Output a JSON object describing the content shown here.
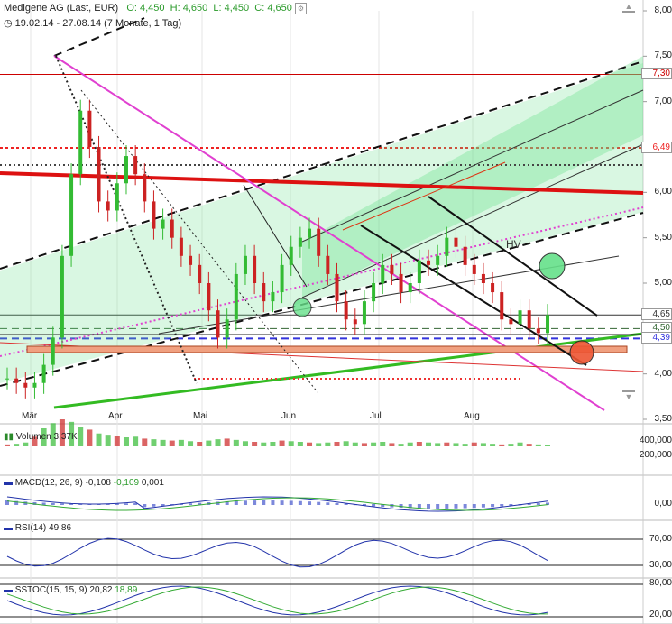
{
  "header": {
    "name": "Medigene AG (Last, EUR)",
    "open": "O: 4,450",
    "high": "H: 4,650",
    "low": "L: 4,450",
    "close": "C: 4,650",
    "range": "19.02.14 - 27.08.14 (7 Monate, 1 Tag)"
  },
  "chart_data": [
    {
      "type": "line",
      "title": "Medigene AG (Last, EUR)",
      "yticks": [
        "8,00",
        "7,50",
        "7,00",
        "6,50",
        "6,00",
        "5,50",
        "5,00",
        "4,50",
        "4,00",
        "3,50"
      ],
      "ylim": [
        3.5,
        8.0
      ],
      "xticks": [
        "Mär",
        "Apr",
        "Mai",
        "Jun",
        "Jul",
        "Aug"
      ],
      "levels": [
        {
          "label": "7,30",
          "value": 7.3,
          "color": "#cc0000"
        },
        {
          "label": "6,49",
          "value": 6.49,
          "color": "#ee2222"
        },
        {
          "label": "4,65",
          "value": 4.65,
          "color": "#333333"
        },
        {
          "label": "4,50",
          "value": 4.5,
          "color": "#336633"
        },
        {
          "label": "4,39",
          "value": 4.39,
          "color": "#3333dd"
        }
      ],
      "annotation": "HV",
      "close": [
        3.95,
        3.9,
        3.85,
        3.9,
        4.1,
        4.4,
        5.3,
        6.2,
        6.9,
        6.5,
        5.9,
        5.8,
        6.1,
        6.4,
        6.2,
        5.9,
        5.6,
        5.7,
        5.5,
        5.3,
        5.2,
        5.0,
        4.7,
        4.4,
        4.6,
        5.1,
        5.3,
        5.0,
        4.8,
        4.9,
        5.2,
        5.4,
        5.5,
        5.6,
        5.3,
        5.1,
        4.8,
        4.6,
        4.55,
        4.8,
        5.0,
        5.2,
        5.1,
        4.9,
        5.0,
        5.25,
        5.2,
        5.3,
        5.5,
        5.4,
        5.2,
        5.1,
        5.0,
        4.9,
        4.6,
        4.55,
        4.7,
        4.5,
        4.45,
        4.65
      ]
    },
    {
      "type": "bar",
      "title": "Volumen",
      "value_label": "3,37K",
      "yticks": [
        "400,000",
        "200,000"
      ],
      "values": [
        30,
        40,
        60,
        150,
        280,
        360,
        420,
        380,
        300,
        260,
        200,
        180,
        160,
        140,
        150,
        120,
        110,
        100,
        90,
        100,
        80,
        70,
        90,
        110,
        120,
        100,
        80,
        70,
        60,
        70,
        90,
        80,
        70,
        60,
        50,
        60,
        70,
        80,
        60,
        50,
        60,
        70,
        50,
        40,
        60,
        70,
        60,
        50,
        60,
        50,
        40,
        60,
        50,
        40,
        30,
        40,
        60,
        40,
        30,
        20
      ]
    },
    {
      "type": "line",
      "title": "MACD(12, 26, 9)",
      "values_label": [
        "-0,108",
        "-0,109",
        "0,001"
      ],
      "yticks": [
        "0,00"
      ]
    },
    {
      "type": "line",
      "title": "RSI(14)",
      "value_label": "49,86",
      "yticks": [
        "70,00",
        "30,00"
      ]
    },
    {
      "type": "line",
      "title": "SSTOC(15, 15, 9)",
      "values_label": [
        "20,82",
        "18,89"
      ],
      "yticks": [
        "80,00",
        "20,00"
      ]
    }
  ]
}
